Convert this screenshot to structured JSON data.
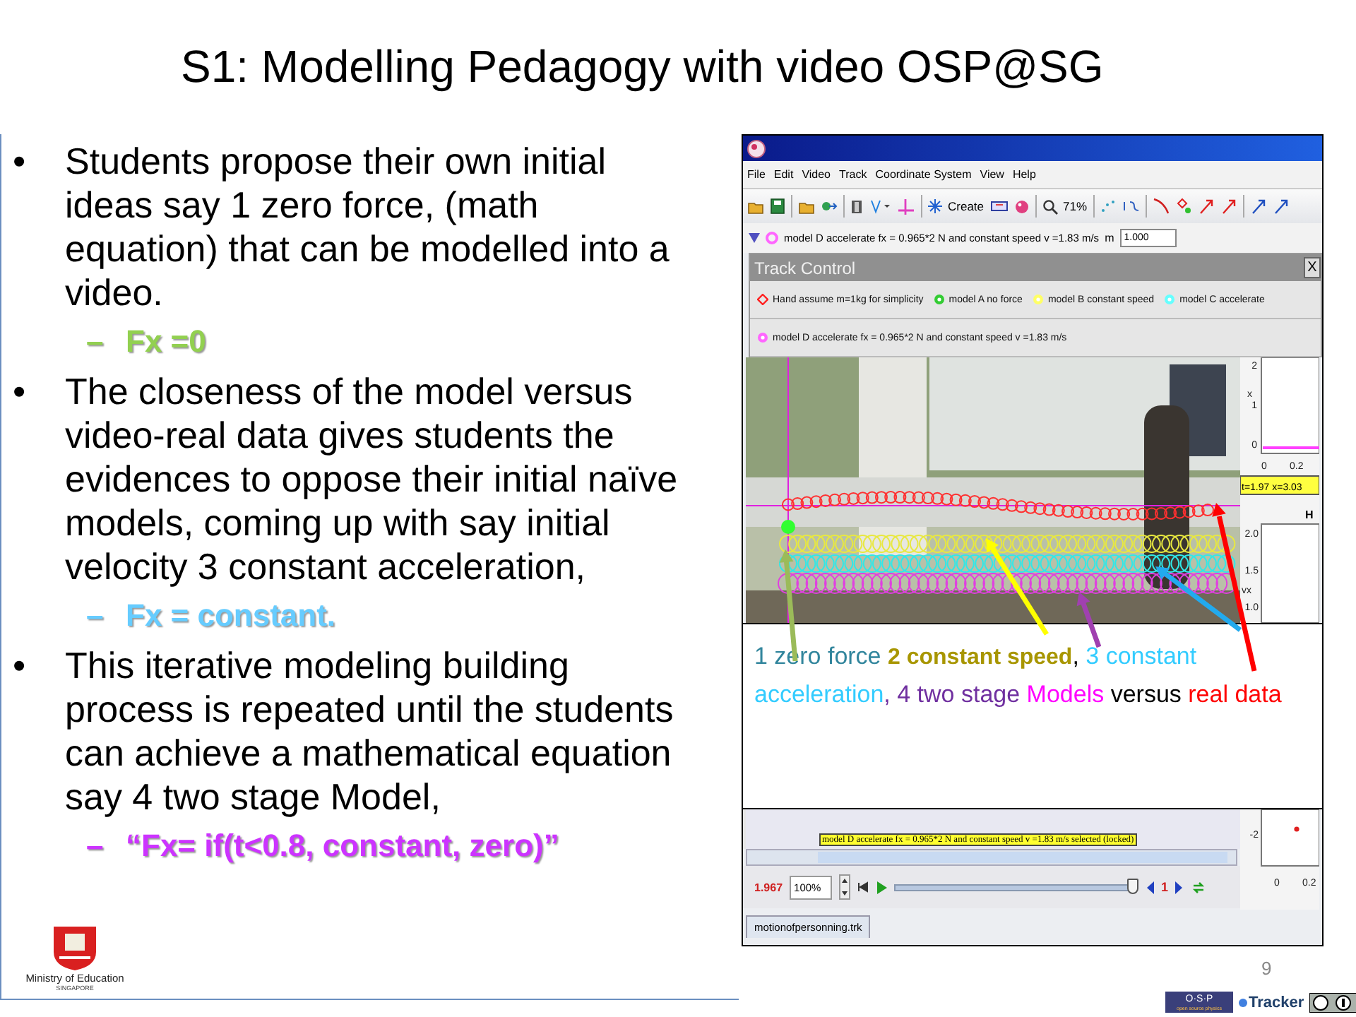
{
  "title": "S1: Modelling Pedagogy with video OSP@SG",
  "bullets": [
    {
      "kind": "main",
      "marker": "•",
      "text": "Students propose their own initial ideas say 1 zero force, (math equation) that can be modelled into a video."
    },
    {
      "kind": "sub",
      "marker": "–",
      "text": "Fx =0",
      "color": "#92d050"
    },
    {
      "kind": "main",
      "marker": "•",
      "text": "The closeness of the model versus video-real data gives students the evidences to oppose their initial naïve models, coming up with say initial velocity 3 constant acceleration,"
    },
    {
      "kind": "sub",
      "marker": "–",
      "text": "Fx = constant.",
      "color": "#66ccff"
    },
    {
      "kind": "main",
      "marker": "•",
      "text": "This iterative modeling building process is repeated until the students can achieve a mathematical equation say 4 two stage Model,"
    },
    {
      "kind": "sub",
      "marker": "–",
      "text": "“Fx= if(t<0.8, constant, zero)”",
      "color": "#cc33ff"
    }
  ],
  "tracker": {
    "menu": [
      "File",
      "Edit",
      "Video",
      "Track",
      "Coordinate System",
      "View",
      "Help"
    ],
    "create_label": "Create",
    "zoom": "71%",
    "track": {
      "name": "model D accelerate fx = 0.965*2 N and constant speed v =1.83 m/s",
      "color": "#ff66ff",
      "mass_label": "m",
      "mass": "1.000"
    },
    "track_control": {
      "title": "Track Control",
      "close": "X",
      "rows": [
        [
          {
            "kind": "diamond",
            "label": "Hand assume m=1kg for simplicity",
            "color": "#ff2020"
          },
          {
            "kind": "circle",
            "label": "model A no force",
            "color": "#33cc33"
          },
          {
            "kind": "circle",
            "label": "model B constant speed",
            "color": "#ffff66"
          },
          {
            "kind": "circle",
            "label": "model C accelerate",
            "color": "#66ffff"
          }
        ],
        [
          {
            "kind": "circle",
            "label": "model D accelerate fx = 0.965*2 N and constant speed v =1.83 m/s",
            "color": "#ff66ff"
          }
        ]
      ]
    },
    "caption": [
      {
        "text": "1 zero force ",
        "color": "#31859c"
      },
      {
        "text": "2 constant speed",
        "color": "#a89600"
      },
      {
        "text": ", ",
        "color": "#000000"
      },
      {
        "text": "3 constant acceleration",
        "color": "#33ccff"
      },
      {
        "text": ", 4 two stage ",
        "color": "#7030a0"
      },
      {
        "text": "Models",
        "color": "#ff00ff"
      },
      {
        "text": " versus ",
        "color": "#000000"
      },
      {
        "text": "real data",
        "color": "#ff0000"
      }
    ],
    "plots": {
      "top_ylabel": "x",
      "top_yticks": [
        "2",
        "1",
        "0"
      ],
      "top_xticks": [
        "0",
        "0.2"
      ],
      "readout": "t=1.97 x=3.03",
      "mid_title": "H",
      "mid_ylabel": "vx",
      "mid_yticks": [
        "2.0",
        "1.5",
        "1.0"
      ],
      "bottom_yticks": [
        "-2"
      ],
      "bottom_xticks": [
        "0",
        "0.2"
      ]
    },
    "tooltip": "model D accelerate fx = 0.965*2 N and constant speed v =1.83 m/s selected (locked)",
    "player": {
      "time": "1.967",
      "rate": "100%",
      "level": 0.98,
      "step": "1"
    },
    "file_tab": "motionofpersonning.trk"
  },
  "footer": {
    "ministry": "Ministry of Education",
    "country": "SINGAPORE",
    "page": "9",
    "osp": "O·S·P",
    "osp_sub": "open source physics",
    "tracker": "Tracker"
  }
}
